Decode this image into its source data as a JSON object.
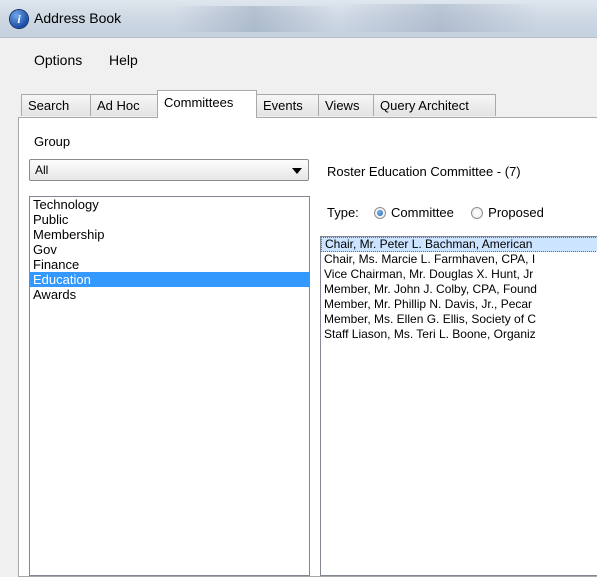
{
  "window": {
    "title": "Address Book",
    "icon": "info-app-icon"
  },
  "menu": {
    "items": [
      "Options",
      "Help"
    ]
  },
  "tabs": [
    {
      "label": "Search",
      "active": false
    },
    {
      "label": "Ad Hoc",
      "active": false
    },
    {
      "label": "Committees",
      "active": true
    },
    {
      "label": "Events",
      "active": false
    },
    {
      "label": "Views",
      "active": false
    },
    {
      "label": "Query Architect",
      "active": false
    }
  ],
  "group": {
    "label": "Group",
    "selected": "All",
    "items": [
      "Technology",
      "Public",
      "Membership",
      "Gov",
      "Finance",
      "Education",
      "Awards"
    ],
    "selected_item": "Education"
  },
  "roster": {
    "label": "Roster  Education Committee - (7)",
    "type_label": "Type:",
    "type_options": [
      {
        "label": "Committee",
        "checked": true
      },
      {
        "label": "Proposed",
        "checked": false
      }
    ],
    "members": [
      "Chair, Mr. Peter L. Bachman, American",
      "Chair, Ms. Marcie L. Farmhaven, CPA, I",
      "Vice Chairman, Mr. Douglas X. Hunt, Jr",
      "Member, Mr. John J. Colby, CPA, Found",
      "Member, Mr. Phillip N. Davis, Jr., Pecar",
      "Member, Ms. Ellen G. Ellis, Society of C",
      "Staff Liason, Ms. Teri L. Boone, Organiz"
    ]
  },
  "colors": {
    "selection": "#3399ff",
    "titlebar": "#cfd9e4"
  }
}
